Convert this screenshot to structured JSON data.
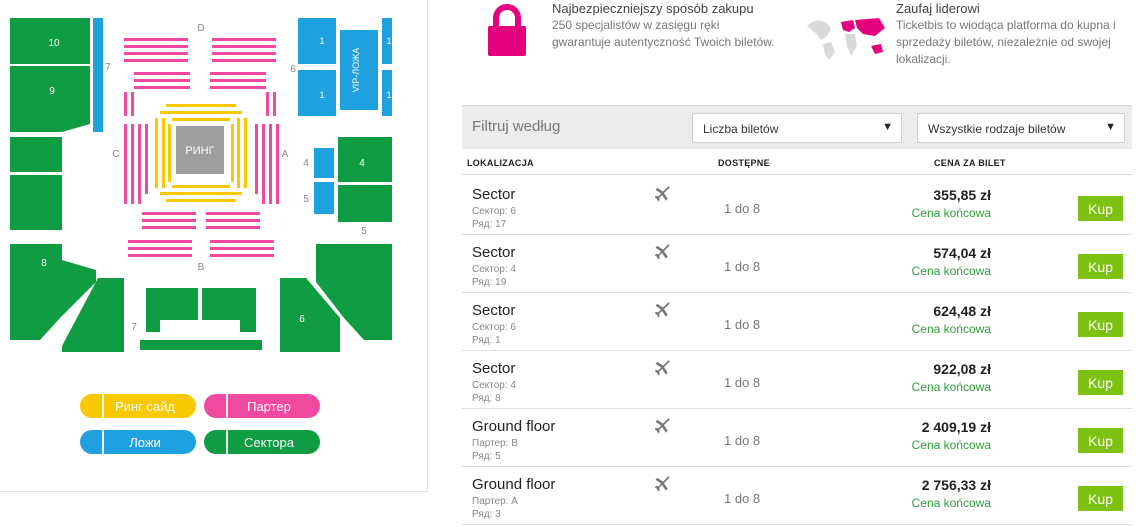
{
  "map": {
    "center_label": "РИНГ",
    "letters": {
      "top": "D",
      "bottom": "B",
      "left": "C",
      "right": "A"
    },
    "sector_numbers": {
      "s10": "10",
      "s9": "9",
      "s8": "8",
      "s6": "6",
      "s4": "4",
      "s5box": "5",
      "bottom7": "7",
      "left7": "7",
      "right6": "6",
      "box4": "4",
      "box5": "5"
    },
    "vip_lozha": "VIP-ЛОЖА",
    "box_one": "1",
    "colors": {
      "green": "#109c43",
      "blue": "#1fa0df",
      "pink": "#f04aa0",
      "yellow": "#f8c800",
      "ring": "#9e9e9e"
    }
  },
  "legend": {
    "ring_side": "Ринг сайд",
    "parter": "Партер",
    "lozhi": "Ложи",
    "sektora": "Сектора"
  },
  "features": {
    "safe": {
      "title": "Najbezpieczniejszy sposób zakupu",
      "line1": "250 specjalistów w zasięgu ręki",
      "line2": "gwarantuje autentyczność Twoich biletów."
    },
    "trust": {
      "title": "Zaufaj liderowi",
      "line1": "Ticketbis to wiodąca platforma do kupna i",
      "line2": "sprzedaży biletów, niezależnie od swojej",
      "line3": "lokalizacji."
    }
  },
  "filter": {
    "label": "Filtruj według",
    "tickets_count": "Liczba biletów",
    "ticket_types": "Wszystkie rodzaje biletów",
    "arrow": "▼"
  },
  "table": {
    "headers": {
      "location": "LOKALIZACJA",
      "available": "DOSTĘPNE",
      "price": "CENA ZA BILET"
    },
    "rows": [
      {
        "location": "Sector",
        "sector": "Сектор: 6",
        "row": "Ряд: 17",
        "available": "1 do 8",
        "price": "355,85 zł",
        "note": "Cena końcowa",
        "buy": "Kup"
      },
      {
        "location": "Sector",
        "sector": "Сектор: 4",
        "row": "Ряд: 19",
        "available": "1 do 8",
        "price": "574,04 zł",
        "note": "Cena końcowa",
        "buy": "Kup"
      },
      {
        "location": "Sector",
        "sector": "Сектор: 6",
        "row": "Ряд: 1",
        "available": "1 do 8",
        "price": "624,48 zł",
        "note": "Cena końcowa",
        "buy": "Kup"
      },
      {
        "location": "Sector",
        "sector": "Сектор: 4",
        "row": "Ряд: 8",
        "available": "1 do 8",
        "price": "922,08 zł",
        "note": "Cena końcowa",
        "buy": "Kup"
      },
      {
        "location": "Ground floor",
        "sector": "Партер: B",
        "row": "Ряд: 5",
        "available": "1 do 8",
        "price": "2 409,19 zł",
        "note": "Cena końcowa",
        "buy": "Kup"
      },
      {
        "location": "Ground floor",
        "sector": "Партер: A",
        "row": "Ряд: 3",
        "available": "1 do 8",
        "price": "2 756,33 zł",
        "note": "Cena końcowa",
        "buy": "Kup"
      }
    ]
  }
}
